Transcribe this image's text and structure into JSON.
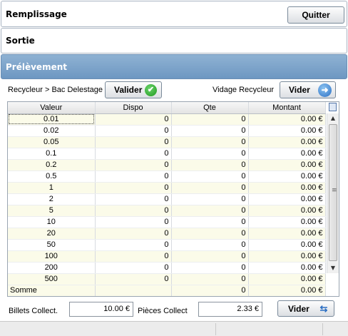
{
  "sections": {
    "remplissage": "Remplissage",
    "sortie": "Sortie",
    "prelevement": "Prélèvement"
  },
  "buttons": {
    "quitter": "Quitter",
    "valider": "Valider",
    "vider_top": "Vider",
    "vider_bottom": "Vider"
  },
  "labels": {
    "recycleur": "Recycleur > Bac Delestage",
    "vidage": "Vidage Recycleur",
    "billets": "Billets Collect.",
    "pieces": "Pièces Collect"
  },
  "fields": {
    "billets": "10.00 €",
    "pieces": "2.33 €"
  },
  "table": {
    "columns": [
      "Valeur",
      "Dispo",
      "Qte",
      "Montant"
    ],
    "rows": [
      [
        "0.01",
        "0",
        "0",
        "0.00 €"
      ],
      [
        "0.02",
        "0",
        "0",
        "0.00 €"
      ],
      [
        "0.05",
        "0",
        "0",
        "0.00 €"
      ],
      [
        "0.1",
        "0",
        "0",
        "0.00 €"
      ],
      [
        "0.2",
        "0",
        "0",
        "0.00 €"
      ],
      [
        "0.5",
        "0",
        "0",
        "0.00 €"
      ],
      [
        "1",
        "0",
        "0",
        "0.00 €"
      ],
      [
        "2",
        "0",
        "0",
        "0.00 €"
      ],
      [
        "5",
        "0",
        "0",
        "0.00 €"
      ],
      [
        "10",
        "0",
        "0",
        "0.00 €"
      ],
      [
        "20",
        "0",
        "0",
        "0.00 €"
      ],
      [
        "50",
        "0",
        "0",
        "0.00 €"
      ],
      [
        "100",
        "0",
        "0",
        "0.00 €"
      ],
      [
        "200",
        "0",
        "0",
        "0.00 €"
      ],
      [
        "500",
        "0",
        "0",
        "0.00 €"
      ]
    ],
    "footer": {
      "label": "Somme",
      "qte": "0",
      "montant": "0.00 €"
    }
  },
  "icons": {
    "valider": "check-icon",
    "vider_top": "arrow-right-icon",
    "vider_bottom": "swap-icon",
    "column_chooser": "column-chooser-icon"
  },
  "colors": {
    "accent_header": "#7ea5cb",
    "row_alt": "#fbfbe9"
  }
}
